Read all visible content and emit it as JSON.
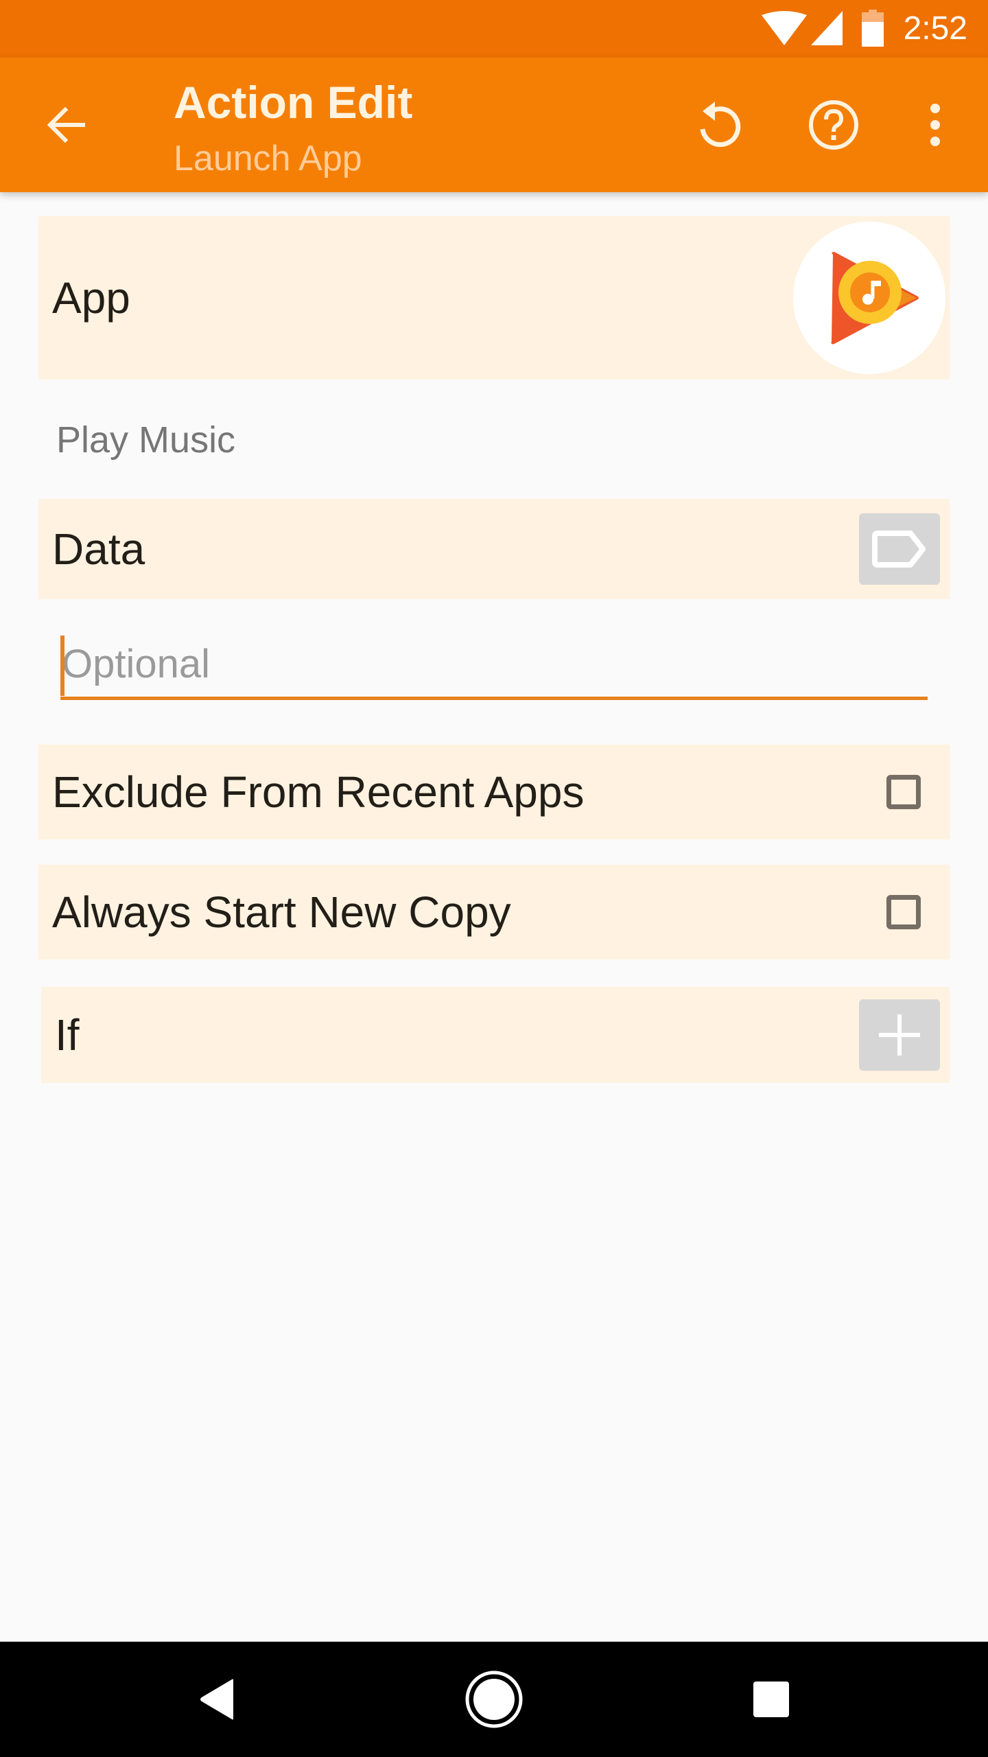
{
  "status_bar": {
    "time": "2:52",
    "icons": [
      "wifi-icon",
      "cell-signal-icon",
      "battery-icon"
    ]
  },
  "app_bar": {
    "title": "Action Edit",
    "subtitle": "Launch App",
    "back_icon": "arrow-left-icon",
    "actions": [
      {
        "name": "reset",
        "icon": "undo-icon"
      },
      {
        "name": "help",
        "icon": "help-circle-icon"
      },
      {
        "name": "more",
        "icon": "more-vert-icon"
      }
    ]
  },
  "form": {
    "app": {
      "label": "App",
      "icon": "play-music-app-icon",
      "selected_app_name": "Play Music"
    },
    "data": {
      "label": "Data",
      "button_icon": "tag-icon",
      "input_value": "",
      "input_placeholder": "Optional"
    },
    "exclude_from_recent": {
      "label": "Exclude From Recent Apps",
      "checked": false
    },
    "always_start_new_copy": {
      "label": "Always Start New Copy",
      "checked": false
    },
    "if_condition": {
      "label": "If",
      "button_icon": "plus-icon"
    }
  },
  "colors": {
    "status_bar": "#EE7102",
    "app_bar": "#F57F05",
    "accent": "#E8821E",
    "card_background": "#FFF2E0",
    "page_background": "#FAFAFA"
  },
  "nav_bar": {
    "buttons": [
      "back-triangle-icon",
      "home-circle-icon",
      "recents-square-icon"
    ]
  }
}
